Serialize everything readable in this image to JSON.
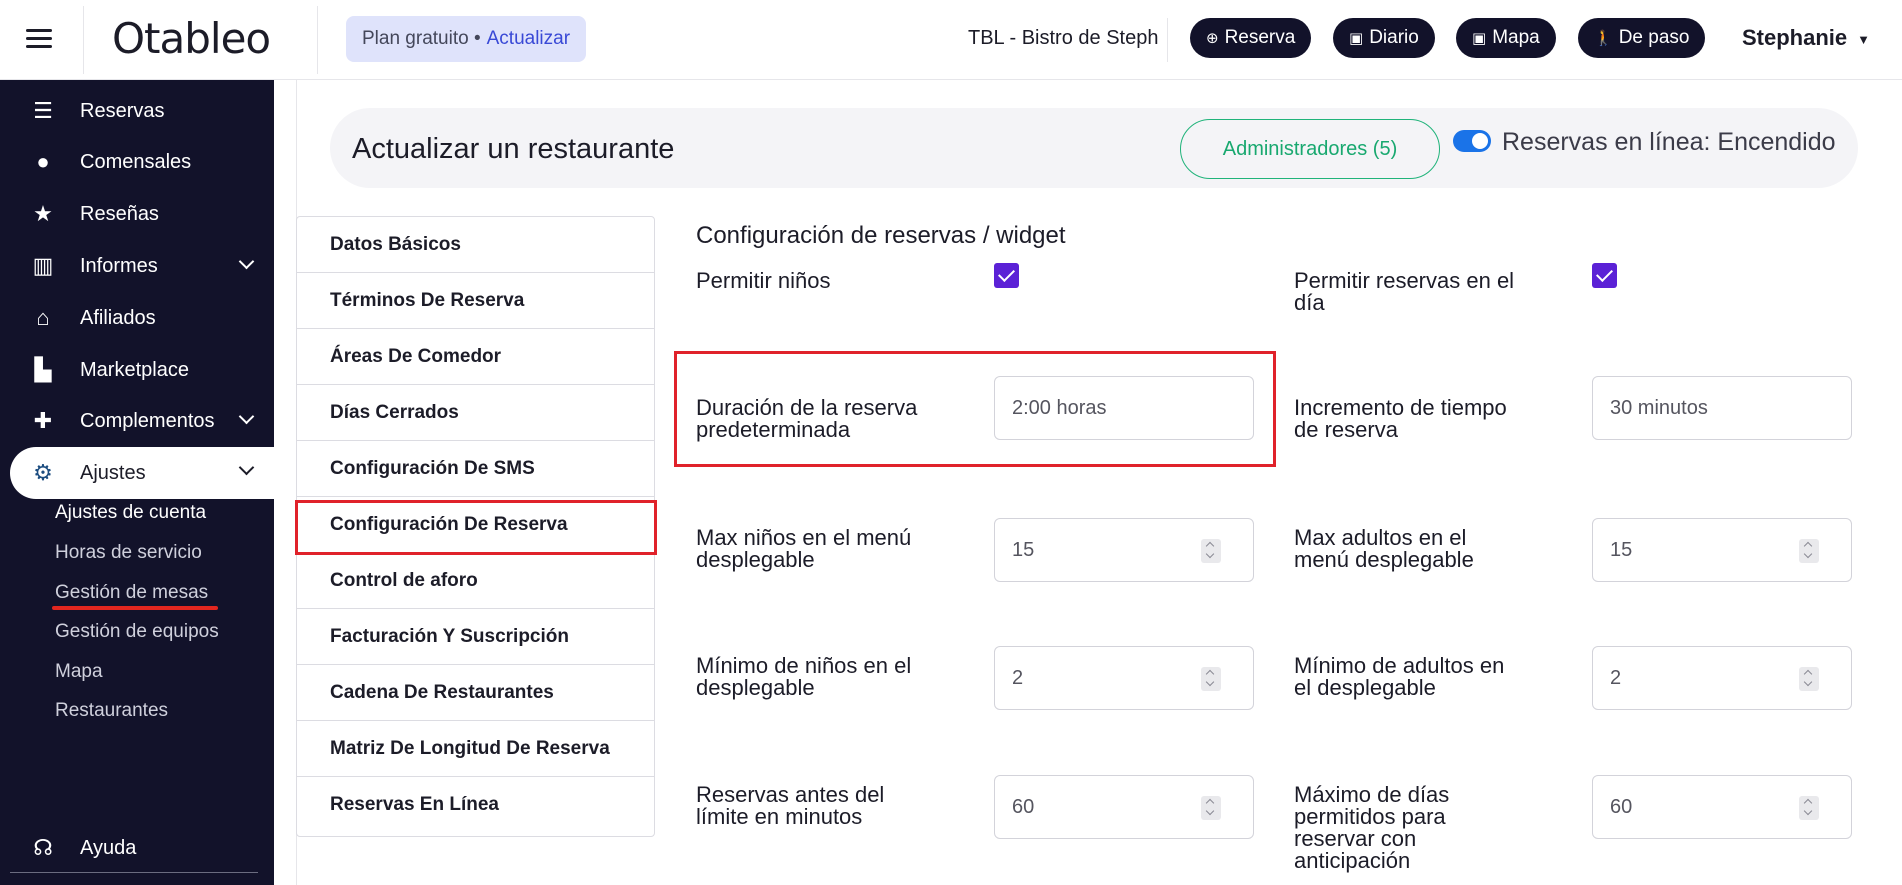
{
  "topbar": {
    "logo": "Otableo",
    "plan_label": "Plan gratuito •",
    "upgrade_label": "Actualizar",
    "restaurant_name": "TBL - Bistro de Steph",
    "buttons": [
      {
        "label": "Reserva",
        "icon": "plus-circle-icon"
      },
      {
        "label": "Diario",
        "icon": "calendar-icon"
      },
      {
        "label": "Mapa",
        "icon": "calendar-icon"
      },
      {
        "label": "De paso",
        "icon": "walking-icon"
      }
    ],
    "user_name": "Stephanie"
  },
  "sidebar": {
    "items": [
      {
        "label": "Reservas",
        "icon": "list-icon"
      },
      {
        "label": "Comensales",
        "icon": "person-icon"
      },
      {
        "label": "Reseñas",
        "icon": "star-icon"
      },
      {
        "label": "Informes",
        "icon": "bar-chart-icon"
      },
      {
        "label": "Afiliados",
        "icon": "cloche-icon"
      },
      {
        "label": "Marketplace",
        "icon": "cart-icon"
      },
      {
        "label": "Complementos",
        "icon": "puzzle-icon"
      },
      {
        "label": "Ajustes",
        "icon": "gear-icon"
      },
      {
        "label": "Ayuda",
        "icon": "headset-icon"
      }
    ],
    "sub_items": [
      "Ajustes de cuenta",
      "Horas de servicio",
      "Gestión de mesas",
      "Gestión de equipos",
      "Mapa",
      "Restaurantes"
    ]
  },
  "header": {
    "title": "Actualizar un restaurante",
    "admins_button": "Administradores (5)",
    "online_label": "Reservas en línea: Encendido",
    "online_enabled": true
  },
  "settings_menu": [
    "Datos Básicos",
    "Términos De Reserva",
    "Áreas De Comedor",
    "Días Cerrados",
    "Configuración De SMS",
    "Configuración De Reserva",
    "Control de aforo",
    "Facturación Y Suscripción",
    "Cadena De Restaurantes",
    "Matriz De Longitud De Reserva",
    "Reservas En Línea"
  ],
  "form": {
    "section_title": "Configuración de reservas / widget",
    "allow_children_label": "Permitir niños",
    "allow_children": true,
    "same_day_label_1": "Permitir reservas en el",
    "same_day_label_2": "día",
    "same_day": true,
    "duration_label_1": "Duración de la reserva",
    "duration_label_2": "predeterminada",
    "duration_value": "2:00 horas",
    "increment_label_1": "Incremento de tiempo",
    "increment_label_2": "de reserva",
    "increment_value": "30 minutos",
    "max_children_label_1": "Max niños en el menú",
    "max_children_label_2": "desplegable",
    "max_children_value": "15",
    "max_adults_label_1": "Max adultos en el",
    "max_adults_label_2": "menú desplegable",
    "max_adults_value": "15",
    "min_children_label_1": "Mínimo de niños en el",
    "min_children_label_2": "desplegable",
    "min_children_value": "2",
    "min_adults_label_1": "Mínimo de adultos en",
    "min_adults_label_2": "el desplegable",
    "min_adults_value": "2",
    "cutoff_label_1": "Reservas antes del",
    "cutoff_label_2": "límite en minutos",
    "cutoff_value": "60",
    "advance_label_1": "Máximo de días",
    "advance_label_2": "permitidos para",
    "advance_label_3": "reservar con",
    "advance_label_4": "anticipación",
    "advance_value": "60"
  },
  "colors": {
    "sidebar_bg": "#12122a",
    "accent_green": "#20b37a",
    "checkbox_purple": "#5b21d6",
    "highlight_red": "#e0222a",
    "toggle_blue": "#1a73e8"
  }
}
